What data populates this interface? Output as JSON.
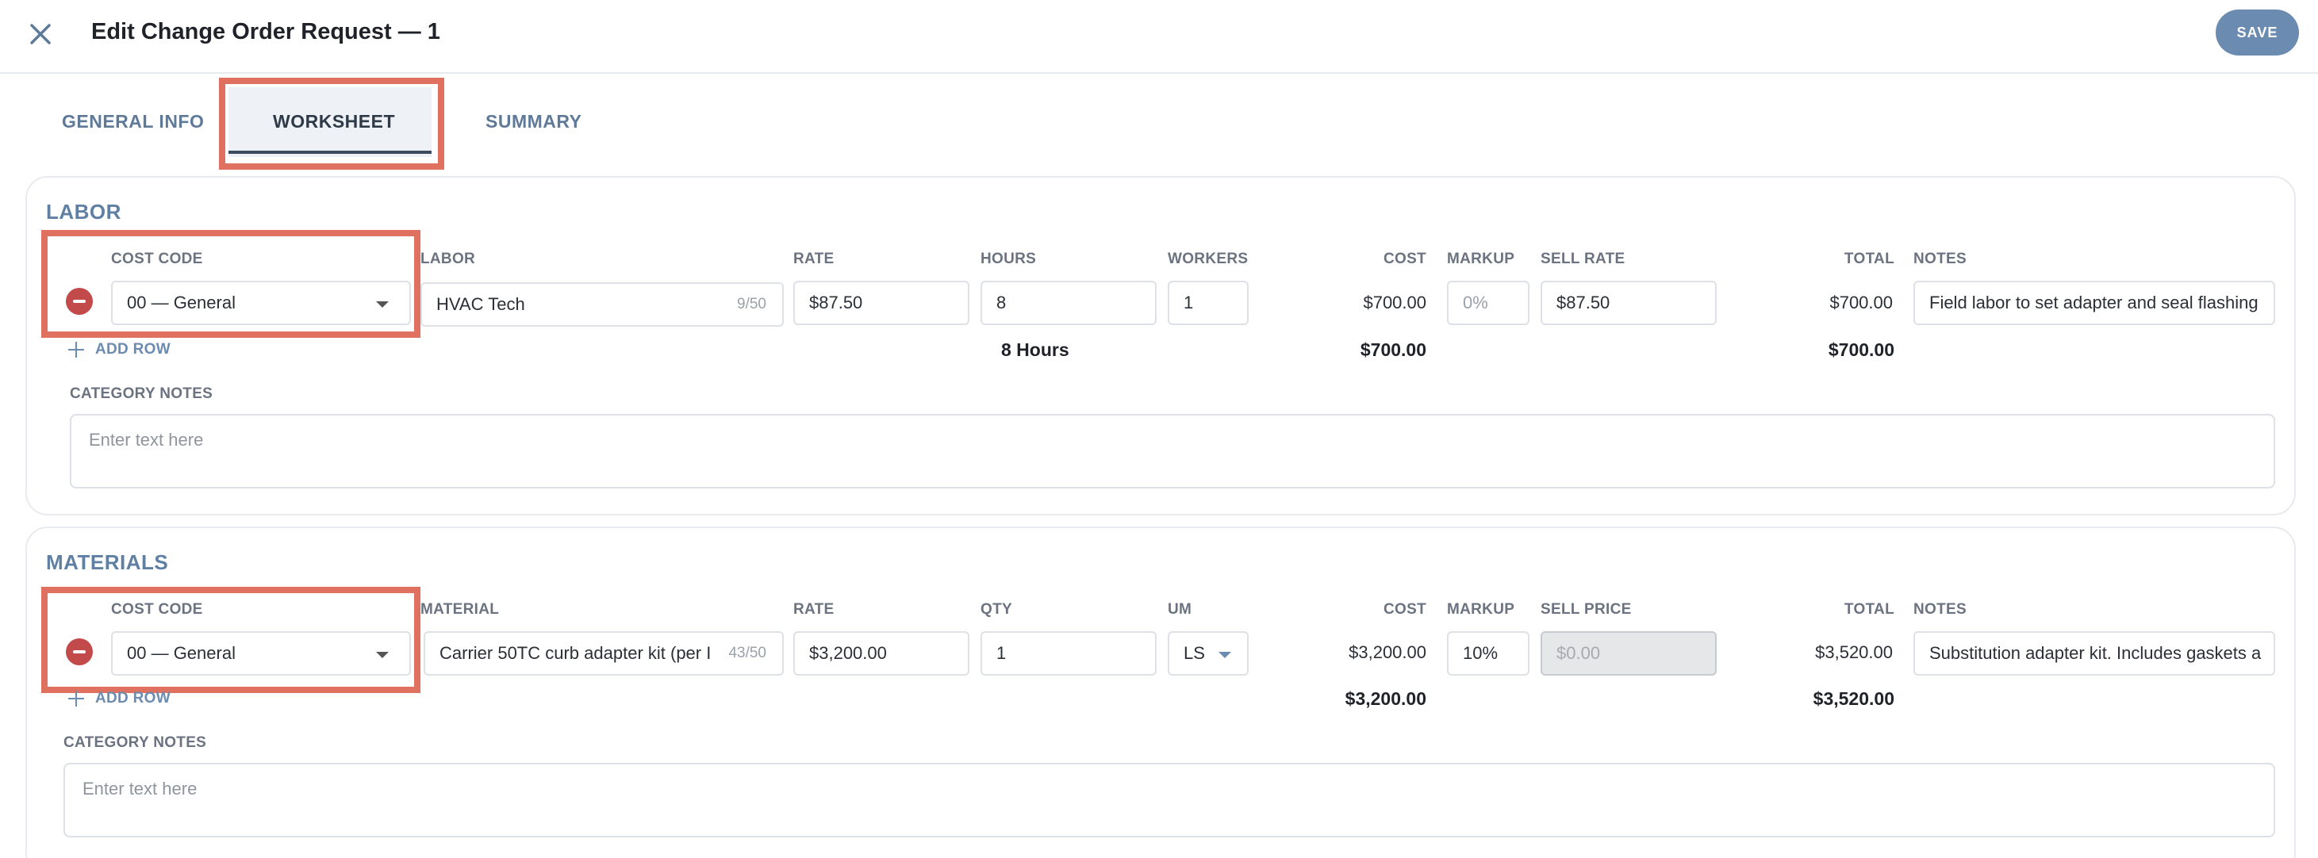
{
  "header": {
    "title": "Edit Change Order Request — 1",
    "save_label": "SAVE",
    "close_icon": "close-icon"
  },
  "tabs": [
    {
      "label": "GENERAL INFO",
      "active": false
    },
    {
      "label": "WORKSHEET",
      "active": true
    },
    {
      "label": "SUMMARY",
      "active": false
    }
  ],
  "colors": {
    "accent": "#6b8bb0",
    "highlight": "#e07060",
    "remove": "#c24a4a",
    "title": "#5f7fa3"
  },
  "labor": {
    "title": "LABOR",
    "columns": {
      "cost_code": "COST CODE",
      "labor": "LABOR",
      "rate": "RATE",
      "hours": "HOURS",
      "workers": "WORKERS",
      "cost": "COST",
      "markup": "MARKUP",
      "sell_rate": "SELL RATE",
      "total": "TOTAL",
      "notes": "NOTES"
    },
    "row": {
      "cost_code": "00 — General",
      "labor": "HVAC Tech",
      "labor_counter": "9/50",
      "rate": "$87.50",
      "hours": "8",
      "workers": "1",
      "cost": "$700.00",
      "markup_placeholder": "0%",
      "sell_rate": "$87.50",
      "total": "$700.00",
      "notes": "Field labor to set adapter and seal flashing"
    },
    "add_row": "ADD ROW",
    "totals": {
      "hours": "8 Hours",
      "cost": "$700.00",
      "total": "$700.00"
    },
    "category_notes_label": "CATEGORY NOTES",
    "category_notes_placeholder": "Enter text here"
  },
  "materials": {
    "title": "MATERIALS",
    "columns": {
      "cost_code": "COST CODE",
      "material": "MATERIAL",
      "rate": "RATE",
      "qty": "QTY",
      "um": "UM",
      "cost": "COST",
      "markup": "MARKUP",
      "sell_price": "SELL PRICE",
      "total": "TOTAL",
      "notes": "NOTES"
    },
    "row": {
      "cost_code": "00 — General",
      "material": "Carrier 50TC curb adapter kit (per I",
      "material_counter": "43/50",
      "rate": "$3,200.00",
      "qty": "1",
      "um": "LS",
      "cost": "$3,200.00",
      "markup": "10%",
      "sell_price_placeholder": "$0.00",
      "total": "$3,520.00",
      "notes": "Substitution adapter kit. Includes gaskets a"
    },
    "add_row": "ADD ROW",
    "totals": {
      "cost": "$3,200.00",
      "total": "$3,520.00"
    },
    "category_notes_label": "CATEGORY NOTES",
    "category_notes_placeholder": "Enter text here"
  }
}
